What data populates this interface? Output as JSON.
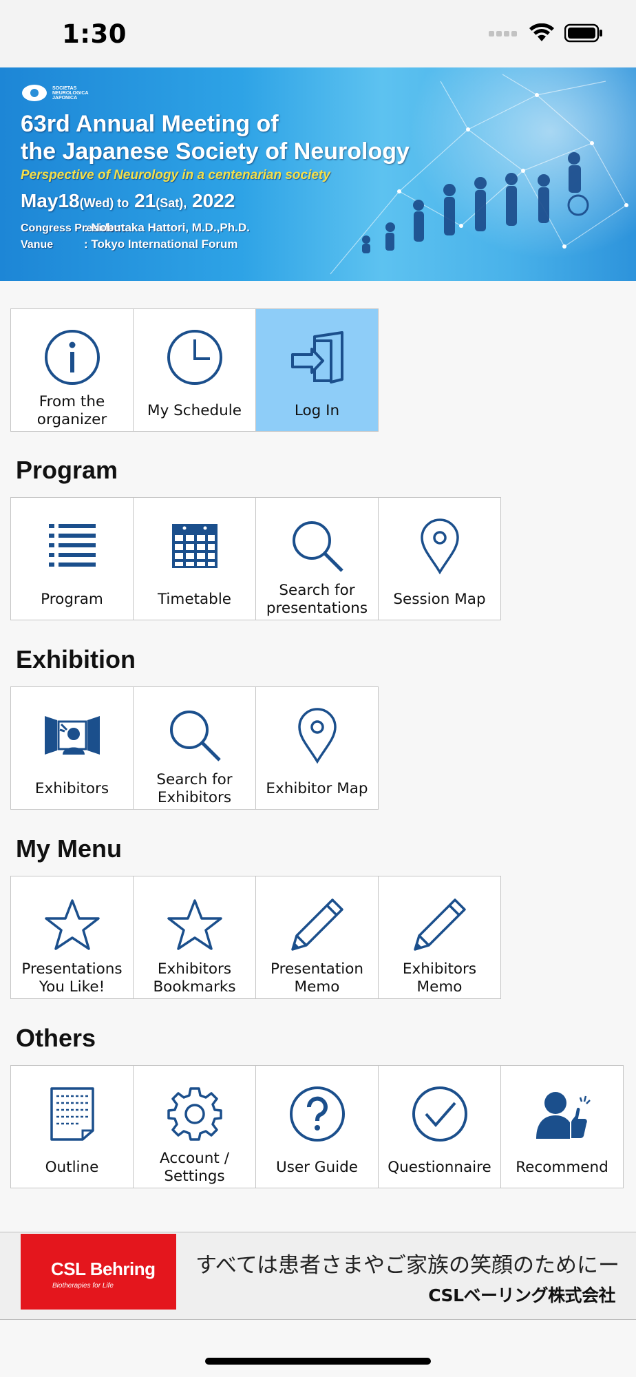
{
  "status_bar": {
    "time": "1:30"
  },
  "banner": {
    "society_logo_text": "SOCIETAS NEUROLOGICA JAPONICA",
    "title_line1": "63rd Annual Meeting of",
    "title_line2": "the Japanese Society of Neurology",
    "subtitle": "Perspective of Neurology in a centenarian society",
    "date_month": "May",
    "date_day1": "18",
    "date_dow1": "(Wed) to",
    "date_day2": "21",
    "date_dow2": "(Sat),",
    "date_year": "2022",
    "president_key": "Congress President",
    "president_value": ": Nobutaka Hattori, M.D.,Ph.D.",
    "venue_key": "Vanue",
    "venue_value": ": Tokyo International Forum"
  },
  "top_tiles": [
    {
      "label": "From the organizer",
      "icon": "info-icon"
    },
    {
      "label": "My Schedule",
      "icon": "clock-icon"
    },
    {
      "label": "Log In",
      "icon": "login-icon"
    }
  ],
  "sections": {
    "program": {
      "title": "Program",
      "tiles": [
        {
          "label": "Program",
          "icon": "list-icon"
        },
        {
          "label": "Timetable",
          "icon": "calendar-icon"
        },
        {
          "label": "Search for presentations",
          "icon": "search-icon"
        },
        {
          "label": "Session Map",
          "icon": "map-pin-icon"
        }
      ]
    },
    "exhibition": {
      "title": "Exhibition",
      "tiles": [
        {
          "label": "Exhibitors",
          "icon": "exhibitor-booth-icon"
        },
        {
          "label": "Search for Exhibitors",
          "icon": "search-icon"
        },
        {
          "label": "Exhibitor Map",
          "icon": "map-pin-icon"
        }
      ]
    },
    "my_menu": {
      "title": "My Menu",
      "tiles": [
        {
          "label": "Presentations You Like!",
          "icon": "star-icon"
        },
        {
          "label": "Exhibitors Bookmarks",
          "icon": "star-icon"
        },
        {
          "label": "Presentation Memo",
          "icon": "pencil-icon"
        },
        {
          "label": "Exhibitors Memo",
          "icon": "pencil-icon"
        }
      ]
    },
    "others": {
      "title": "Others",
      "tiles": [
        {
          "label": "Outline",
          "icon": "document-icon"
        },
        {
          "label": "Account / Settings",
          "icon": "gear-icon"
        },
        {
          "label": "User Guide",
          "icon": "question-icon"
        },
        {
          "label": "Questionnaire",
          "icon": "check-circle-icon"
        },
        {
          "label": "Recommend",
          "icon": "thumbs-up-person-icon"
        }
      ]
    }
  },
  "ad": {
    "brand": "CSL Behring",
    "tagline": "Biotherapies for Life",
    "text": "すべては患者さまやご家族の笑顔のためにー",
    "company": "CSLベーリング株式会社"
  },
  "colors": {
    "icon_blue": "#1b4f8c",
    "active_tile": "#8ecdf8",
    "ad_red": "#e4161d"
  }
}
